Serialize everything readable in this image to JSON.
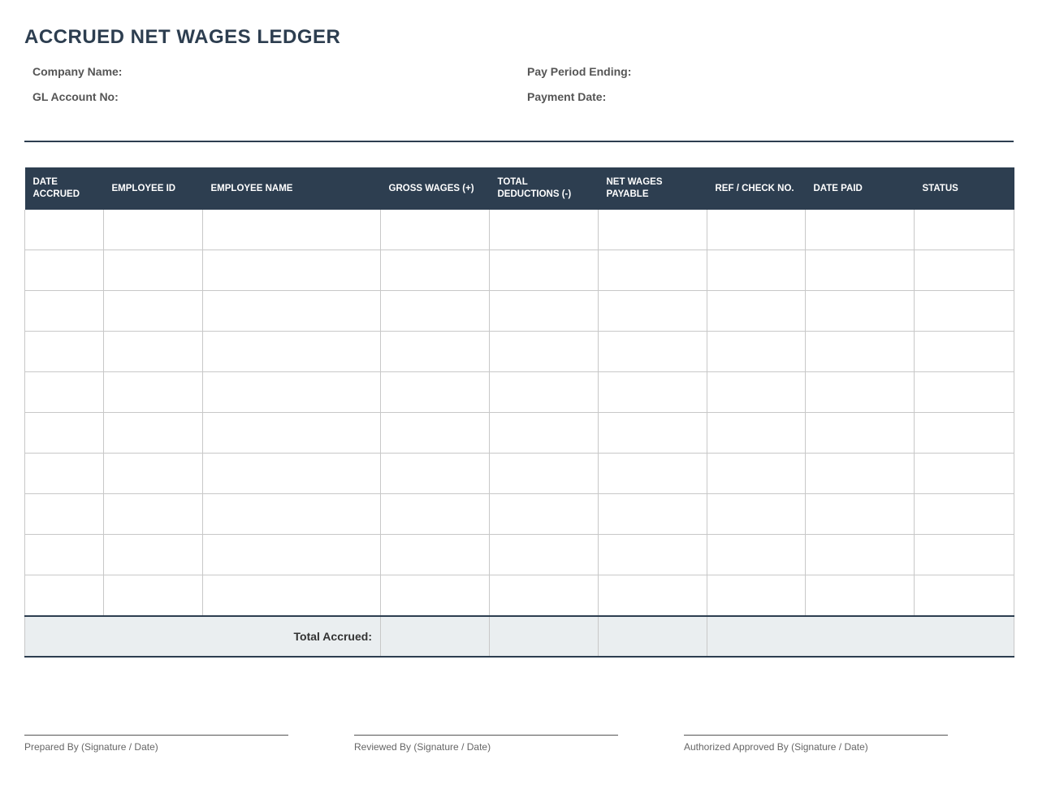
{
  "title": "ACCRUED NET WAGES LEDGER",
  "fields": {
    "company_name": "Company Name:",
    "gl_account_no": "GL Account No:",
    "pay_period_ending": "Pay Period Ending:",
    "payment_date": "Payment Date:"
  },
  "table": {
    "headers": [
      "DATE ACCRUED",
      "EMPLOYEE ID",
      "EMPLOYEE NAME",
      "GROSS WAGES (+)",
      "TOTAL DEDUCTIONS (-)",
      "NET WAGES PAYABLE",
      "REF / CHECK NO.",
      "DATE PAID",
      "STATUS"
    ],
    "rows": [
      [
        "",
        "",
        "",
        "",
        "",
        "",
        "",
        "",
        ""
      ],
      [
        "",
        "",
        "",
        "",
        "",
        "",
        "",
        "",
        ""
      ],
      [
        "",
        "",
        "",
        "",
        "",
        "",
        "",
        "",
        ""
      ],
      [
        "",
        "",
        "",
        "",
        "",
        "",
        "",
        "",
        ""
      ],
      [
        "",
        "",
        "",
        "",
        "",
        "",
        "",
        "",
        ""
      ],
      [
        "",
        "",
        "",
        "",
        "",
        "",
        "",
        "",
        ""
      ],
      [
        "",
        "",
        "",
        "",
        "",
        "",
        "",
        "",
        ""
      ],
      [
        "",
        "",
        "",
        "",
        "",
        "",
        "",
        "",
        ""
      ],
      [
        "",
        "",
        "",
        "",
        "",
        "",
        "",
        "",
        ""
      ],
      [
        "",
        "",
        "",
        "",
        "",
        "",
        "",
        "",
        ""
      ]
    ],
    "total_label": "Total Accrued:",
    "totals": {
      "gross_wages": "",
      "total_deductions": "",
      "net_wages_payable": ""
    }
  },
  "signatures": [
    "Prepared By (Signature / Date)",
    "Reviewed By (Signature / Date)",
    "Authorized Approved By (Signature / Date)"
  ],
  "colors": {
    "header_bg": "#2d3e50",
    "total_row_bg": "#eaeef0",
    "grid": "#c8c8c8"
  }
}
